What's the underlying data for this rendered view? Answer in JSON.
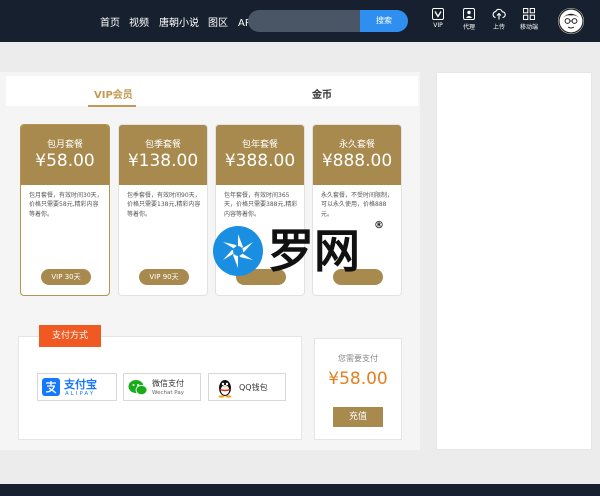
{
  "nav": {
    "links": [
      "首页",
      "视频",
      "唐朝小说",
      "图区",
      "APP下载"
    ],
    "search": {
      "value": "",
      "button_label": "搜索"
    },
    "tools": [
      {
        "label": "VIP",
        "icon": "vip-icon"
      },
      {
        "label": "代理",
        "icon": "agent-icon"
      },
      {
        "label": "上传",
        "icon": "upload-icon"
      },
      {
        "label": "移动端",
        "icon": "grid-icon"
      }
    ]
  },
  "tabs": [
    "VIP会员",
    "金币"
  ],
  "plans": [
    {
      "title": "包月套餐",
      "price": "¥58.00",
      "desc": "包月套餐，有效时间30天，价格只需要58元,精彩内容等着你。",
      "button": "VIP 30天"
    },
    {
      "title": "包季套餐",
      "price": "¥138.00",
      "desc": "包季套餐，有效时间90天，价格只需要138元,精彩内容等着你。",
      "button": "VIP 90天"
    },
    {
      "title": "包年套餐",
      "price": "¥388.00",
      "desc": "包年套餐，有效时间365天，价格只需要388元,精彩内容等着你。",
      "button": ""
    },
    {
      "title": "永久套餐",
      "price": "¥888.00",
      "desc": "永久套餐，不受时间限制，可以永久使用，价格888元。",
      "button": ""
    }
  ],
  "payment": {
    "tag": "支付方式",
    "alipay": {
      "name": "支付宝",
      "sub": "ALIPAY"
    },
    "wechat": {
      "name": "微信支付",
      "sub": "Wechat Pay"
    },
    "qq": {
      "name": "QQ钱包"
    }
  },
  "summary": {
    "label": "您需要支付",
    "price": "¥58.00",
    "button": "充值"
  },
  "watermark": {
    "text": "罗网",
    "mark": "®"
  },
  "colors": {
    "gold": "#a8894e",
    "orange": "#f05a22",
    "price": "#e38022",
    "nav_bg": "#16202e",
    "search_btn": "#2e8ff0"
  }
}
